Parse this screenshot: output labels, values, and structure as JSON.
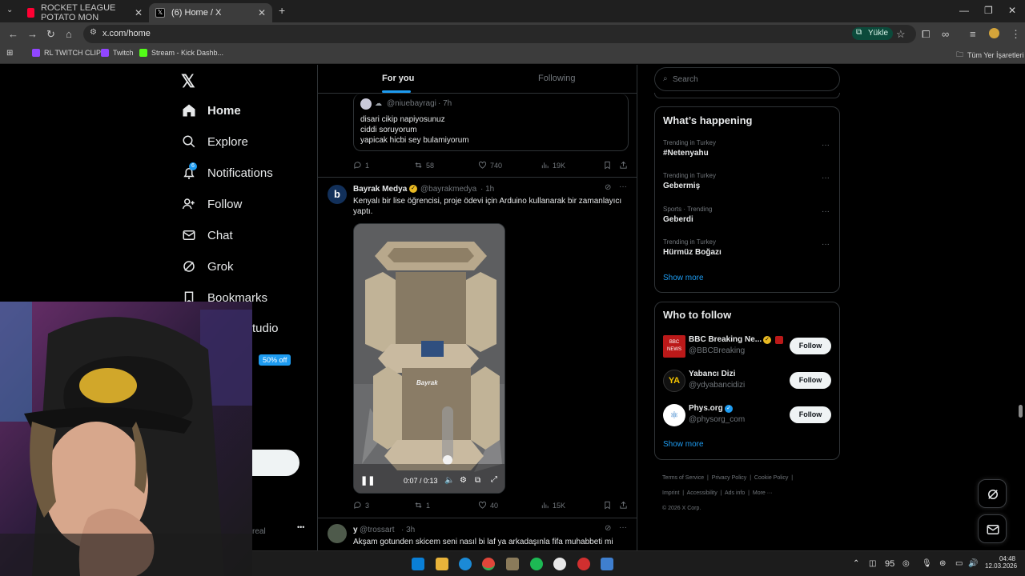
{
  "browser": {
    "tabs": [
      {
        "title": "ROCKET LEAGUE POTATO MON",
        "favicon_color": "#ff0033"
      },
      {
        "title": "(6) Home / X",
        "favicon_color": "#000000"
      }
    ],
    "url": "x.com/home",
    "install_button": "Yükle",
    "bookmarks": [
      {
        "label": "RL TWITCH CLIPS",
        "color": "#9146ff"
      },
      {
        "label": "Twitch",
        "color": "#9146ff"
      },
      {
        "label": "Stream - Kick Dashb...",
        "color": "#53fc18"
      }
    ],
    "all_bookmarks": "Tüm Yer İşaretleri"
  },
  "nav": {
    "items": [
      {
        "label": "Home",
        "icon": "home-icon"
      },
      {
        "label": "Explore",
        "icon": "search-icon"
      },
      {
        "label": "Notifications",
        "icon": "bell-icon",
        "badge": "6"
      },
      {
        "label": "Follow",
        "icon": "follow-icon"
      },
      {
        "label": "Chat",
        "icon": "mail-icon"
      },
      {
        "label": "Grok",
        "icon": "grok-icon"
      },
      {
        "label": "Bookmarks",
        "icon": "bookmark-icon"
      }
    ],
    "studio_partial": "tudio",
    "premium_badge": "50% off",
    "profile_partial": "real",
    "more_dots": "•••"
  },
  "feed": {
    "tabs": [
      "For you",
      "Following"
    ],
    "quoted": {
      "handle": "@niuebayragi",
      "time": "· 7h",
      "lines": [
        "disari cikip napiyosunuz",
        "ciddi soruyorum",
        "yapicak hicbi sey bulamiyorum"
      ]
    },
    "post1_stats": {
      "replies": "1",
      "reposts": "58",
      "likes": "740",
      "views": "19K"
    },
    "post2": {
      "name": "Bayrak Medya",
      "handle": "@bayrakmedya",
      "time": "· 1h",
      "text": "Kenyalı bir lise öğrencisi, proje ödevi için Arduino kullanarak bir zamanlayıcı yaptı.",
      "video_time": "0:07 / 0:13",
      "watermark": "Bayrak",
      "stats": {
        "replies": "3",
        "reposts": "1",
        "likes": "40",
        "views": "15K"
      }
    },
    "post3": {
      "name": "y",
      "handle": "@trossart",
      "time": "· 3h",
      "text": "Akşam gotunden skicem seni nasıl bi laf ya arkadaşınla fifa muhabbeti mi"
    }
  },
  "sidebar": {
    "search_placeholder": "Search",
    "happening_title": "What’s happening",
    "trends": [
      {
        "context": "Trending in Turkey",
        "name": "#Netenyahu"
      },
      {
        "context": "Trending in Turkey",
        "name": "Gebermiş"
      },
      {
        "context": "Sports · Trending",
        "name": "Geberdi"
      },
      {
        "context": "Trending in Turkey",
        "name": "Hürmüz Boğazı"
      }
    ],
    "show_more": "Show more",
    "who_title": "Who to follow",
    "follow": [
      {
        "name": "BBC Breaking Ne...",
        "handle": "@BBCBreaking",
        "avatar_color": "#bb1919",
        "button": "Follow"
      },
      {
        "name": "Yabancı Dizi",
        "handle": "@ydyabancidizi",
        "avatar_color": "#111111",
        "button": "Follow"
      },
      {
        "name": "Phys.org",
        "handle": "@physorg_com",
        "avatar_color": "#ffffff",
        "button": "Follow"
      }
    ],
    "show_more_2": "Show more",
    "footer_links": [
      "Terms of Service",
      "Privacy Policy",
      "Cookie Policy",
      "Imprint",
      "Accessibility",
      "Ads info",
      "More ···"
    ],
    "copyright": "© 2026 X Corp."
  },
  "taskbar": {
    "temp": "95",
    "time": "04:48",
    "date": "12.03.2026"
  },
  "colors": {
    "accent": "#1d9bf0",
    "background": "#000000",
    "border": "#2f3336"
  }
}
